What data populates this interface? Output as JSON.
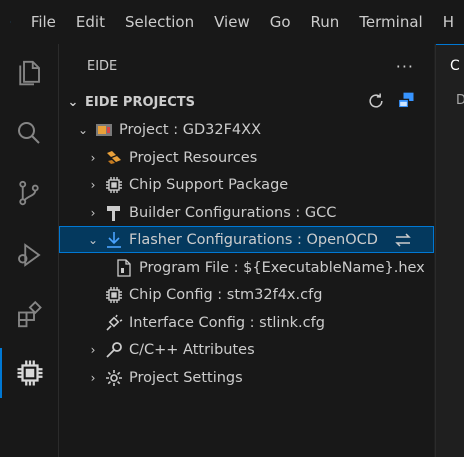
{
  "menu": [
    "File",
    "Edit",
    "Selection",
    "View",
    "Go",
    "Run",
    "Terminal",
    "H"
  ],
  "sidebar": {
    "title": "EIDE",
    "more": "···",
    "section_title": "EIDE PROJECTS"
  },
  "tree": {
    "project": "Project : GD32F4XX",
    "project_resources": "Project Resources",
    "chip_support": "Chip Support Package",
    "builder": "Builder Configurations : GCC",
    "flasher": "Flasher Configurations : OpenOCD",
    "program_file": "Program File : ${ExecutableName}.hex",
    "chip_config": "Chip Config : stm32f4x.cfg",
    "interface_config": "Interface Config : stlink.cfg",
    "cpp_attributes": "C/C++ Attributes",
    "project_settings": "Project Settings"
  },
  "editor": {
    "tab_label": "C",
    "breadcrumb": "D"
  },
  "colors": {
    "accent": "#0078d4",
    "selected_bg": "#04395e",
    "sidebar_bg": "#181818"
  }
}
